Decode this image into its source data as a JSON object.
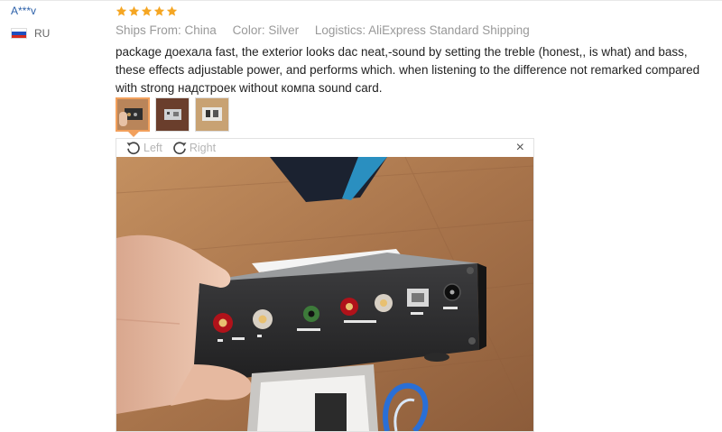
{
  "review": {
    "user": "A***v",
    "country": "RU",
    "rating": 5,
    "ships_from": "Ships From: China",
    "color": "Color: Silver",
    "logistics": "Logistics: AliExpress Standard Shipping",
    "comment": "package доехала fast, the exterior looks dac neat,-sound by setting the treble (honest,, is what) and bass, these effects adjustable power, and performs which. when listening to the difference not remarked compared with strong надстроек without компа sound card."
  },
  "viewer": {
    "rotate_left_label": "Left",
    "rotate_right_label": "Right",
    "close_label": "×"
  },
  "colors": {
    "star": "#f5a623",
    "link": "#2b5fa8",
    "accent": "#f2a05c"
  },
  "icons": [
    "star-icon",
    "russia-flag-icon",
    "rotate-left-icon",
    "rotate-right-icon",
    "close-icon"
  ]
}
